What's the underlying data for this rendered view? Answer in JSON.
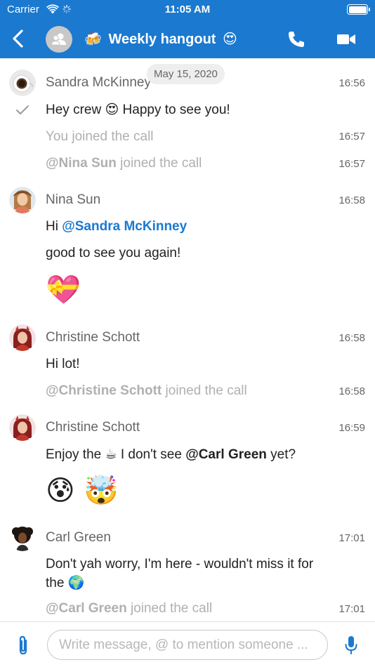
{
  "status_bar": {
    "carrier": "Carrier",
    "time": "11:05 AM",
    "battery_level": 1.0
  },
  "header": {
    "title": "Weekly hangout",
    "title_prefix_emoji": "🍻",
    "title_suffix_emoji": "😍",
    "icons": [
      "back-chevron-icon",
      "group-avatar-icon",
      "phone-icon",
      "video-camera-icon"
    ]
  },
  "date_pill": "May 15, 2020",
  "messages": [
    {
      "name": "Sandra McKinney",
      "time": "16:56"
    },
    {
      "text_a": "Hey crew ",
      "emoji": "😍",
      "text_b": " Happy to see you!"
    },
    {
      "system": "You joined the call",
      "time": "16:57"
    },
    {
      "mention": "@Nina Sun",
      "system": " joined the call",
      "time": "16:57"
    },
    {
      "name": "Nina Sun",
      "time": "16:58"
    },
    {
      "text": "Hi ",
      "mention": "@Sandra McKinney"
    },
    {
      "text": "good to see you again!"
    },
    {
      "emoji": "💝"
    },
    {
      "name": "Christine Schott",
      "time": "16:58"
    },
    {
      "text": "Hi lot!"
    },
    {
      "mention": "@Christine Schott",
      "system": " joined the call",
      "time": "16:58"
    },
    {
      "name": "Christine Schott",
      "time": "16:59"
    },
    {
      "text_a": "Enjoy the ",
      "emoji": "☕",
      "text_b": " I don't see ",
      "mention": "@Carl Green",
      "text_c": " yet?"
    },
    {
      "emoji": "😰 🤯"
    },
    {
      "name": "Carl Green",
      "time": "17:01"
    },
    {
      "text_line1": "Don't yah worry, I'm here - wouldn't miss it for",
      "text_line2": "the ",
      "emoji": "🌍"
    },
    {
      "mention": "@Carl Green",
      "system": " joined the call",
      "time": "17:01"
    }
  ],
  "composer": {
    "placeholder": "Write message, @ to mention someone ...",
    "value": ""
  },
  "colors": {
    "accent": "#1b79cf",
    "system_text": "#b0b0b0",
    "meta_text": "#666666"
  }
}
